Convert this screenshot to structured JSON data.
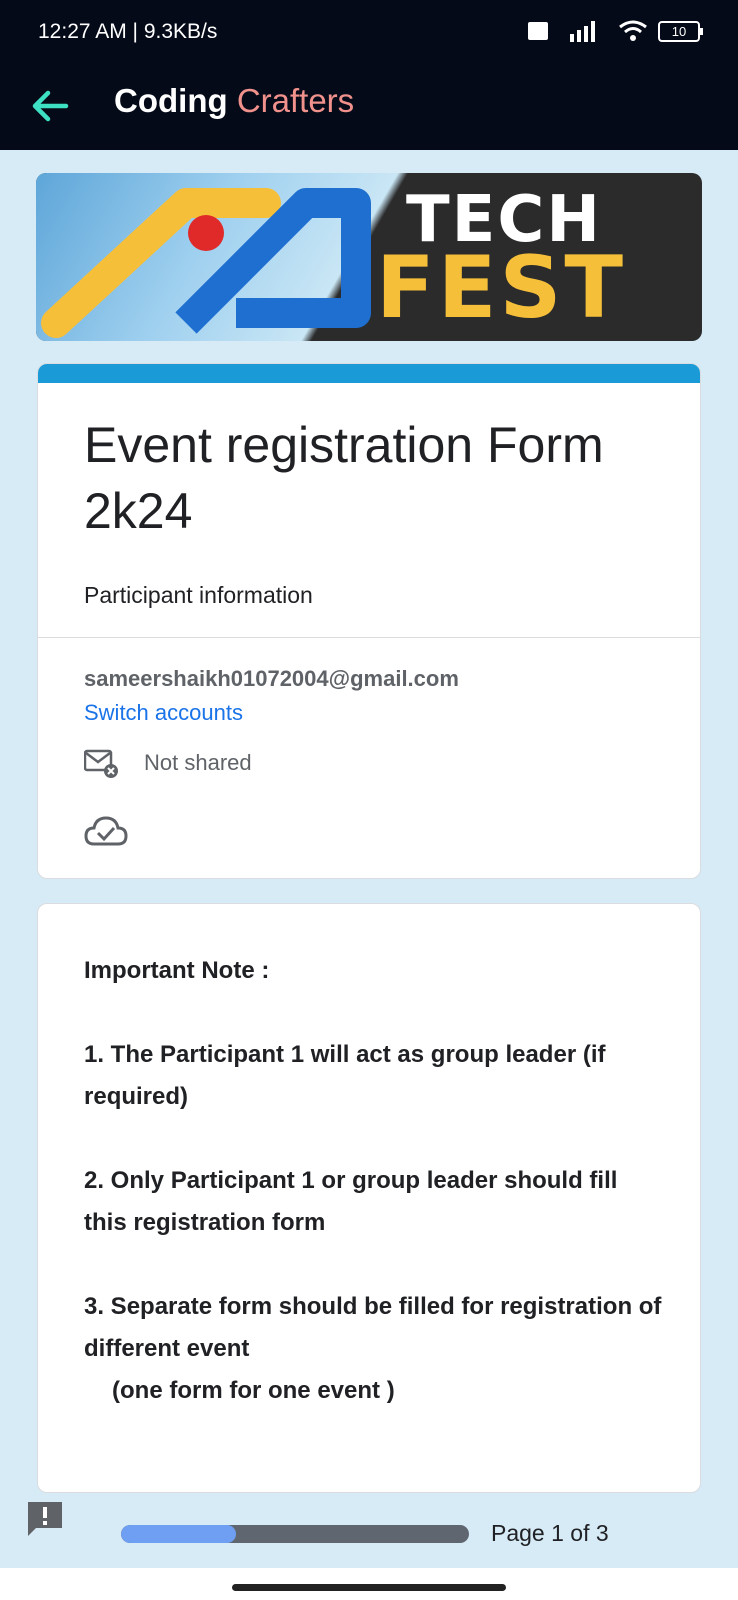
{
  "status_bar": {
    "time_speed": "12:27 AM | 9.3KB/s",
    "battery": "10"
  },
  "app_bar": {
    "brand_part1": "Coding",
    "brand_part2": "Crafters"
  },
  "banner": {
    "line1": "TECH",
    "line2": "FEST"
  },
  "form": {
    "title": "Event registration Form 2k24",
    "description": "Participant information",
    "email": "sameershaikh01072004@gmail.com",
    "switch_accounts": "Switch accounts",
    "not_shared": "Not shared"
  },
  "note": {
    "heading": "Important Note :",
    "item1": "1. The Participant 1 will act as group leader (if required)",
    "item2": "2. Only Participant 1 or group leader should fill this registration form",
    "item3_line1": "3. Separate form should be filled for registration of different event",
    "item3_line2": "(one form for one event )"
  },
  "footer": {
    "page_label": "Page 1 of 3",
    "progress_fraction": 0.33
  },
  "colors": {
    "accent_blue": "#1a9bd7",
    "link_blue": "#1a73e8",
    "brand_accent": "#f0918c",
    "back_arrow": "#3ee0c4"
  }
}
